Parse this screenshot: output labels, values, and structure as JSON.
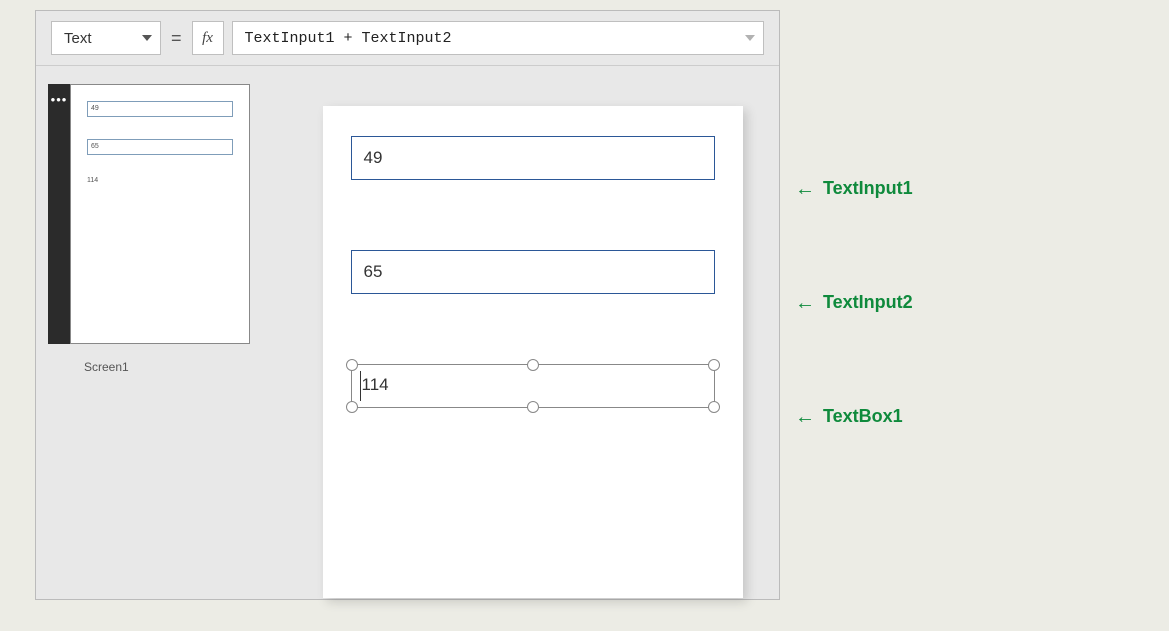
{
  "formula_bar": {
    "property": "Text",
    "fx_label": "fx",
    "expression": "TextInput1 + TextInput2",
    "equals": "="
  },
  "nav": {
    "more": "•••",
    "screen_label": "Screen1",
    "thumb": {
      "v1": "49",
      "v2": "65",
      "v3": "114"
    }
  },
  "canvas": {
    "input1": "49",
    "input2": "65",
    "result": "114"
  },
  "annotations": {
    "a1": "TextInput1",
    "a2": "TextInput2",
    "a3": "TextBox1",
    "arrow": "←"
  }
}
